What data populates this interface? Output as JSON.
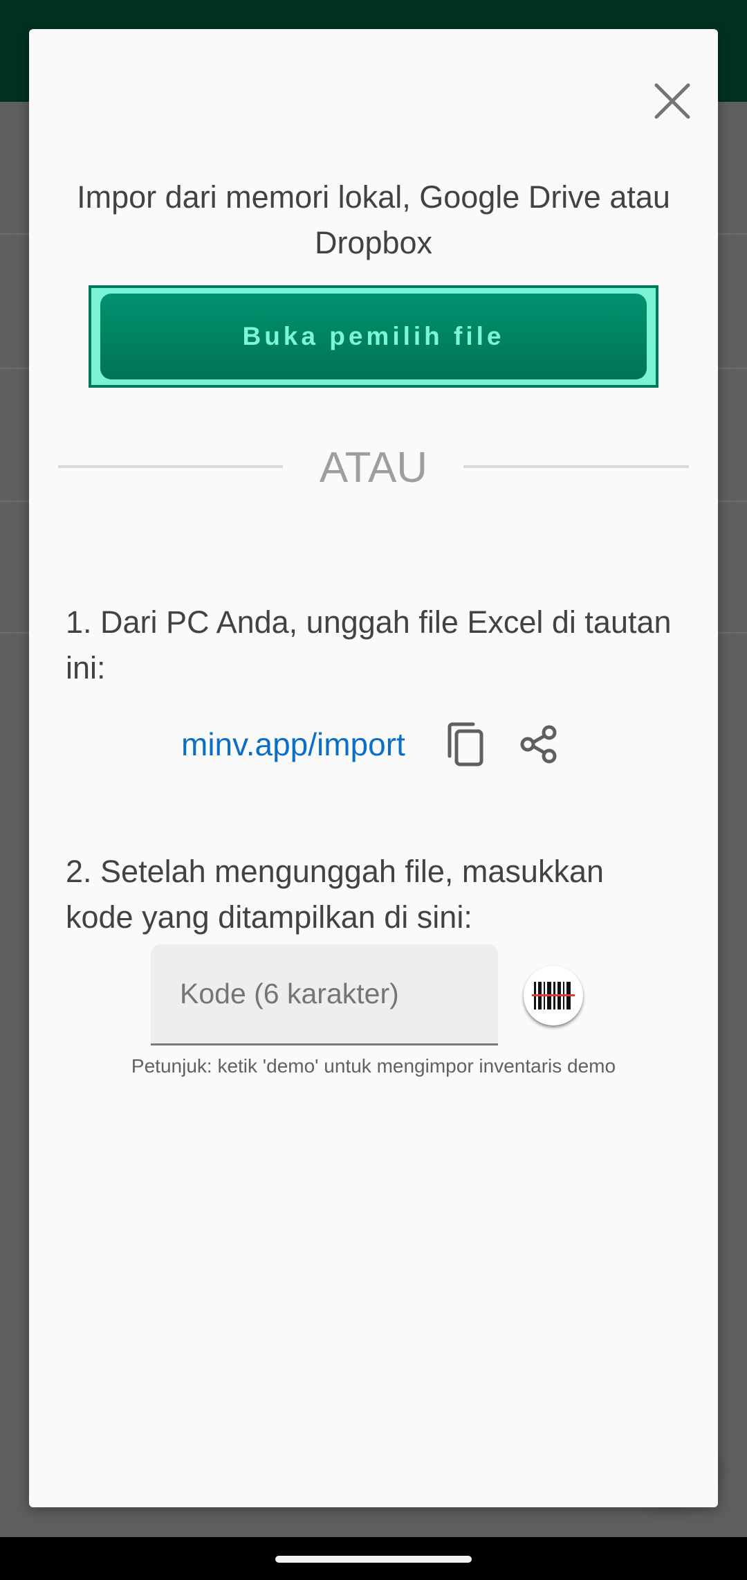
{
  "dialog": {
    "close_icon": "close-icon",
    "import_title": "Impor dari memori lokal, Google Drive atau Dropbox",
    "file_picker_button": "Buka pemilih file",
    "or_label": "ATAU",
    "step1_text": "1. Dari PC Anda, unggah file Excel di tautan ini:",
    "import_link": "minv.app/import",
    "copy_icon": "copy-icon",
    "share_icon": "share-icon",
    "step2_text": "2. Setelah mengunggah file, masukkan kode yang ditampilkan di sini:",
    "code_input": {
      "placeholder": "Kode (6 karakter)",
      "value": ""
    },
    "scan_icon": "barcode-scan-icon",
    "hint_text": "Petunjuk: ketik 'demo' untuk mengimpor inventaris demo"
  },
  "colors": {
    "header": "#00321f",
    "button": "#00936f",
    "button_text": "#7df5d8",
    "button_outline": "#79f2d5",
    "link": "#0b6fc9",
    "scan_line": "#e53935"
  }
}
